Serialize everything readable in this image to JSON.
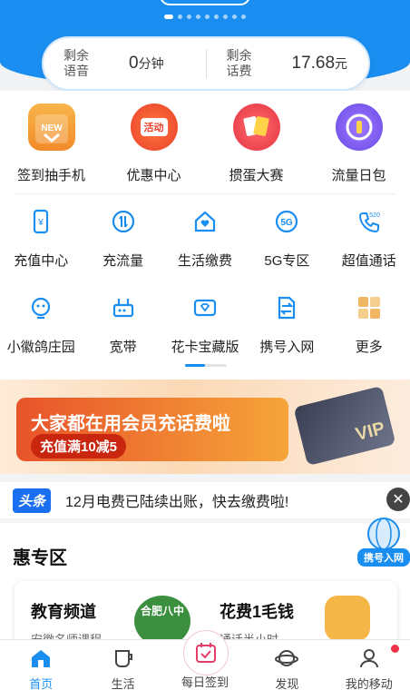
{
  "colors": {
    "primary": "#1a8ef0",
    "text": "#222222",
    "red": "#f0324a"
  },
  "header": {
    "carousel_page_count": 9,
    "carousel_active_index": 0
  },
  "balance": {
    "voice": {
      "label": "剩余语音",
      "value": "0",
      "unit": "分钟"
    },
    "fee": {
      "label": "剩余话费",
      "value": "17.68",
      "unit": "元"
    }
  },
  "featured": [
    {
      "label": "签到抽手机",
      "icon": "calendar-gift-icon",
      "badge": "NEW"
    },
    {
      "label": "优惠中心",
      "icon": "shopping-bag-icon",
      "badge": "活动"
    },
    {
      "label": "掼蛋大赛",
      "icon": "playing-cards-icon",
      "badge": ""
    },
    {
      "label": "流量日包",
      "icon": "flow-package-icon",
      "badge": ""
    }
  ],
  "services": [
    {
      "label": "充值中心",
      "icon": "phone-recharge-icon"
    },
    {
      "label": "充流量",
      "icon": "data-flow-icon"
    },
    {
      "label": "生活缴费",
      "icon": "home-heart-icon"
    },
    {
      "label": "5G专区",
      "icon": "5g-icon"
    },
    {
      "label": "超值通话",
      "icon": "call-520-icon"
    },
    {
      "label": "小徽鸽庄园",
      "icon": "pigeon-icon"
    },
    {
      "label": "宽带",
      "icon": "router-icon"
    },
    {
      "label": "花卡宝藏版",
      "icon": "card-diamond-icon"
    },
    {
      "label": "携号入网",
      "icon": "number-transfer-icon"
    },
    {
      "label": "更多",
      "icon": "grid-more-icon"
    }
  ],
  "banner": {
    "title": "大家都在用会员充话费啦",
    "subtitle": "充值满10减5",
    "card_text": "VIP"
  },
  "notice": {
    "tag": "头条",
    "text": "12月电费已陆续出账，快去缴费啦!"
  },
  "float_badge": {
    "label": "携号入网"
  },
  "section": {
    "title": "惠专区",
    "cards": [
      {
        "title": "教育频道",
        "subtitle": "安徽名师课程",
        "image_text": "合肥八中"
      },
      {
        "title": "花费1毛钱",
        "subtitle": "通话半小时"
      }
    ]
  },
  "tabbar": [
    {
      "label": "首页",
      "icon": "home-icon",
      "active": true
    },
    {
      "label": "生活",
      "icon": "cup-icon",
      "active": false
    },
    {
      "label": "每日签到",
      "icon": "calendar-check-icon",
      "active": false
    },
    {
      "label": "发现",
      "icon": "planet-icon",
      "active": false
    },
    {
      "label": "我的移动",
      "icon": "user-icon",
      "active": false
    }
  ]
}
